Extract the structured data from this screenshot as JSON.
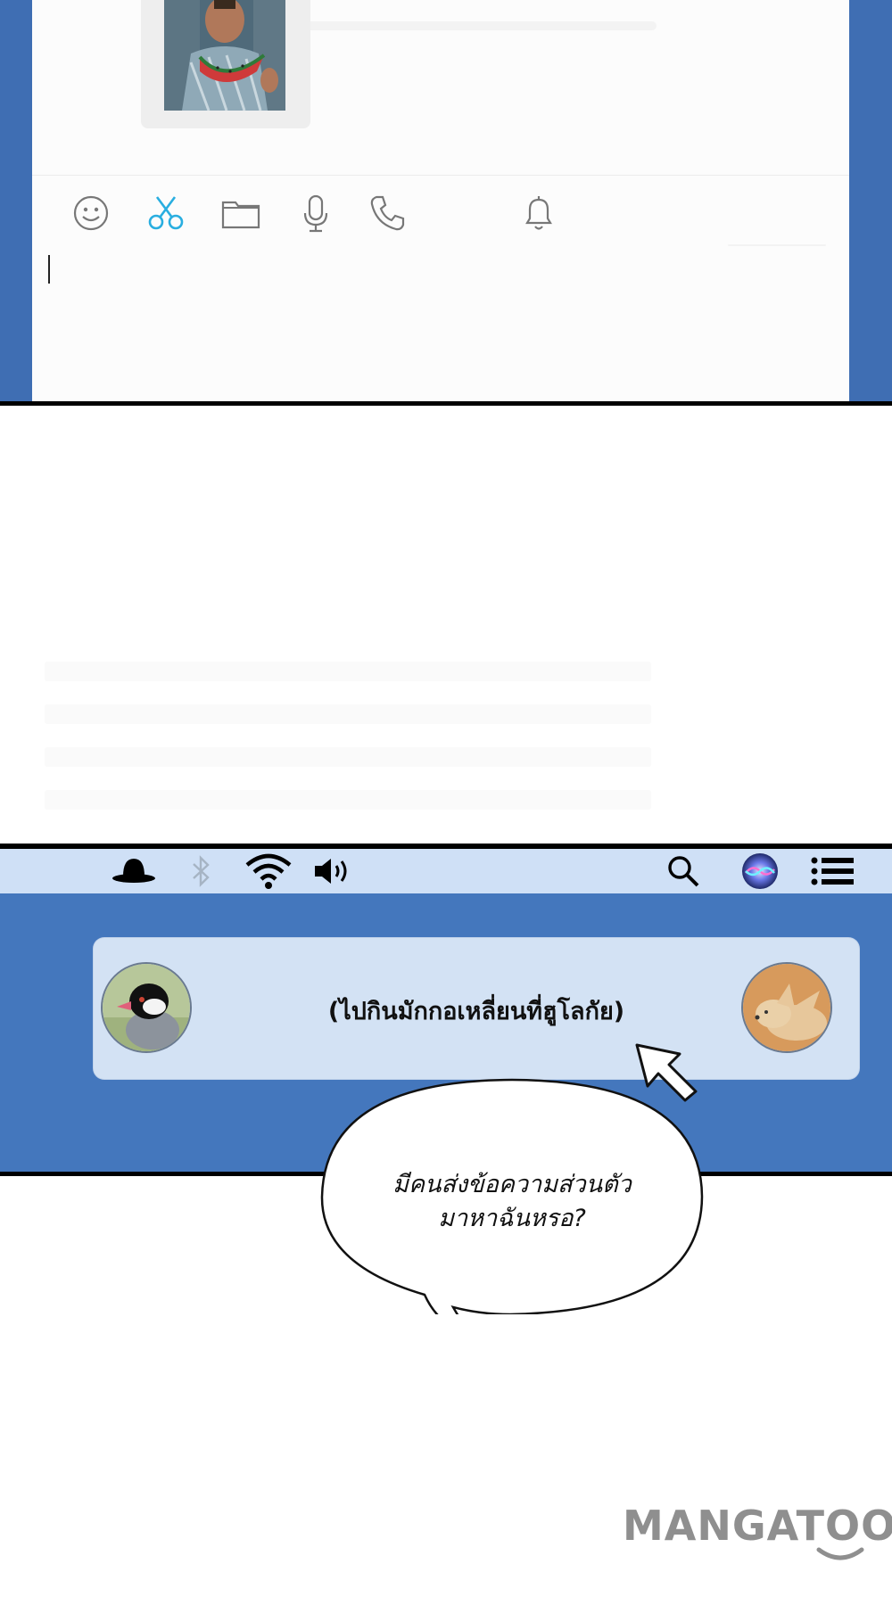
{
  "chat_window": {
    "toolbar": {
      "icons": [
        "emoji-icon",
        "scissors-icon",
        "folder-icon",
        "microphone-icon",
        "phone-icon",
        "bell-icon"
      ],
      "accent_color": "#29aee0"
    }
  },
  "menubar": {
    "background": "#cfe0f6",
    "icons": [
      "hat-icon",
      "bluetooth-icon",
      "wifi-icon",
      "volume-icon",
      "search-icon",
      "siri-icon",
      "list-icon"
    ]
  },
  "notification": {
    "text": "(ไปกินมักกอเหลี่ยนที่ฮูโลกัย)",
    "left_avatar": "bird-avatar",
    "right_avatar": "fox-avatar"
  },
  "speech_bubble": {
    "line1": "มีคนส่งข้อความส่วนตัว",
    "line2": "มาหาฉันหรอ?"
  },
  "watermark": {
    "text": "MANGATOON"
  }
}
